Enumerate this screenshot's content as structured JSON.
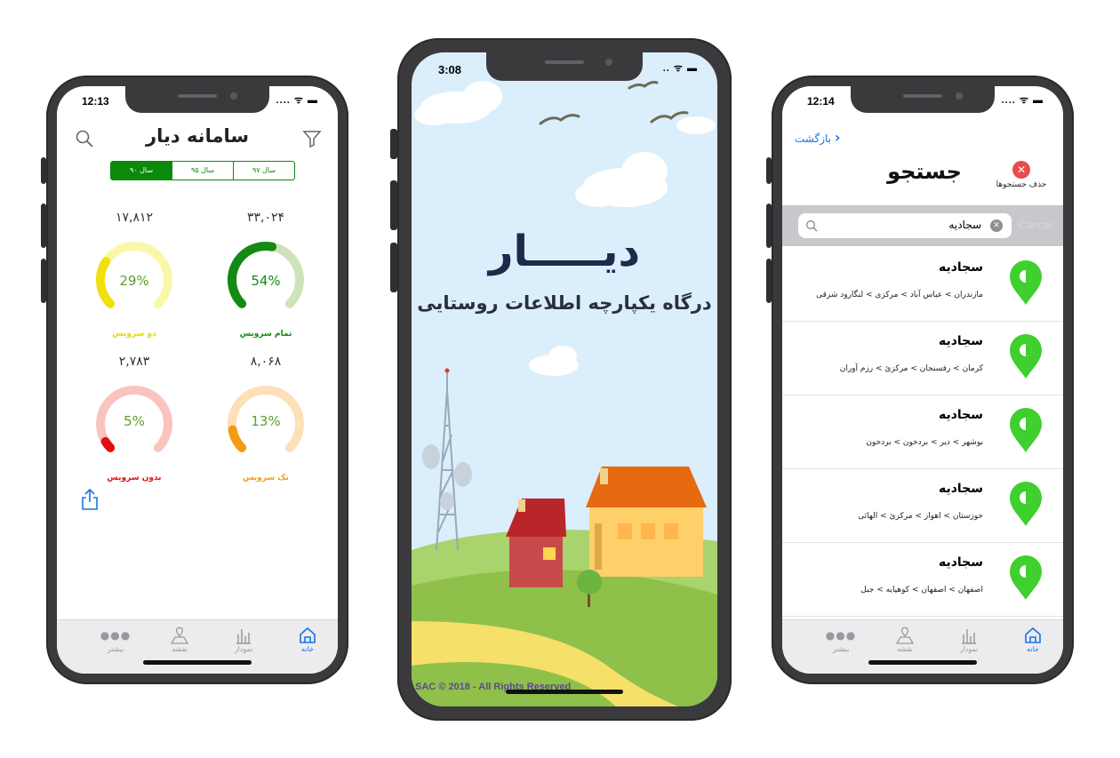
{
  "phone1": {
    "status_time": "12:13",
    "title": "سامانه دیار",
    "years": [
      "سال ۹۷",
      "سال ۹۵",
      "سال ۹۰"
    ],
    "active_year_index": 2,
    "gauges": [
      {
        "value": "۳۳,۰۲۴",
        "percent_text": "54%",
        "percent": 54,
        "label": "تمام سرویس",
        "color": "#138a13",
        "track": "#cfe3b8"
      },
      {
        "value": "۱۷,۸۱۲",
        "percent_text": "29%",
        "percent": 29,
        "label": "دو سرویس",
        "color": "#f0e010",
        "track": "#fbf7a8"
      },
      {
        "value": "۸,۰۶۸",
        "percent_text": "13%",
        "percent": 13,
        "label": "تک سرویس",
        "color": "#f39c12",
        "track": "#fde0b8"
      },
      {
        "value": "۲,۷۸۳",
        "percent_text": "5%",
        "percent": 5,
        "label": "بدون سرویس",
        "color": "#e01010",
        "track": "#f9c4c0"
      }
    ]
  },
  "phone2": {
    "status_time": "3:08",
    "logo": "دیـــــار",
    "subtitle": "درگاه یکپارچه اطلاعات روستایی",
    "footer": "SAC © 2018 - All Rights Reserved"
  },
  "phone3": {
    "status_time": "12:14",
    "back_label": "بازگشت",
    "title": "جستجو",
    "clear_label": "حذف جستجوها",
    "search_value": "سجادیه",
    "cancel_label": "Cancel",
    "results": [
      {
        "title": "سجادیه",
        "path": "مازندران > عباس آباد > مرکزی > لنگارود شرقی"
      },
      {
        "title": "سجادیه",
        "path": "کرمان > رفسنجان > مرکزئ > رزم آوران"
      },
      {
        "title": "سجادیه",
        "path": "بوشهر > دیر > بردخون > بردخون"
      },
      {
        "title": "سجادیه",
        "path": "خوزستان > اهواز > مرکزئ > الهائی"
      },
      {
        "title": "سجادیه",
        "path": "اصفهان > اصفهان > کوهپایه > جبل"
      }
    ]
  },
  "tabs": [
    {
      "label": "خانه",
      "icon": "home-icon"
    },
    {
      "label": "نمودار",
      "icon": "chart-icon"
    },
    {
      "label": "نقشه",
      "icon": "map-icon"
    },
    {
      "label": "بیشتر",
      "icon": "more-icon"
    }
  ],
  "colors": {
    "green": "#0a8a0a",
    "blue": "#1a73e8",
    "pin": "#3fcf2f"
  }
}
